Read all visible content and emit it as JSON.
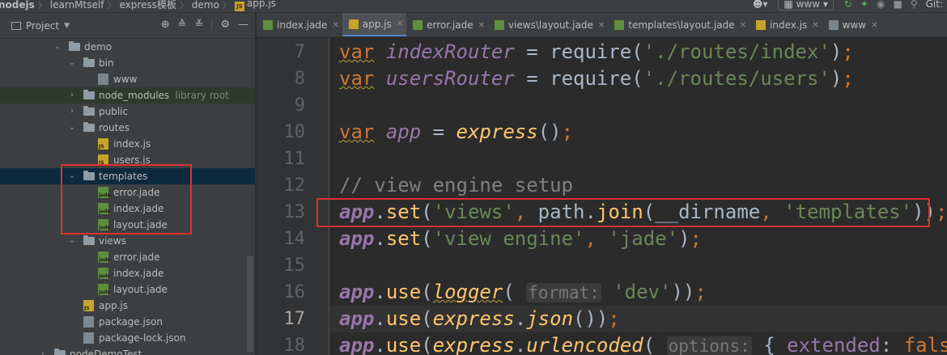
{
  "breadcrumb": {
    "items": [
      "nodejs",
      "learnMtself",
      "express模板",
      "demo",
      "app.js"
    ]
  },
  "toolbar": {
    "run_config": "www",
    "git_label": "Git:"
  },
  "project_panel": {
    "title": "Project",
    "tree": [
      {
        "label": "demo",
        "type": "folder",
        "depth": 0,
        "expanded": true
      },
      {
        "label": "bin",
        "type": "folder",
        "depth": 1,
        "expanded": true
      },
      {
        "label": "www",
        "type": "file-bin",
        "depth": 2
      },
      {
        "label": "node_modules",
        "type": "folder",
        "depth": 1,
        "expanded": false,
        "note": "library root"
      },
      {
        "label": "public",
        "type": "folder",
        "depth": 1,
        "expanded": false
      },
      {
        "label": "routes",
        "type": "folder",
        "depth": 1,
        "expanded": true
      },
      {
        "label": "index.js",
        "type": "file-js",
        "depth": 2
      },
      {
        "label": "users.js",
        "type": "file-js",
        "depth": 2
      },
      {
        "label": "templates",
        "type": "folder",
        "depth": 1,
        "expanded": true,
        "selected": true
      },
      {
        "label": "error.jade",
        "type": "file-jade",
        "depth": 2
      },
      {
        "label": "index.jade",
        "type": "file-jade",
        "depth": 2
      },
      {
        "label": "layout.jade",
        "type": "file-jade",
        "depth": 2
      },
      {
        "label": "views",
        "type": "folder",
        "depth": 1,
        "expanded": true
      },
      {
        "label": "error.jade",
        "type": "file-jade",
        "depth": 2
      },
      {
        "label": "index.jade",
        "type": "file-jade",
        "depth": 2
      },
      {
        "label": "layout.jade",
        "type": "file-jade",
        "depth": 2
      },
      {
        "label": "app.js",
        "type": "file-js",
        "depth": 1
      },
      {
        "label": "package.json",
        "type": "file-json",
        "depth": 1
      },
      {
        "label": "package-lock.json",
        "type": "file-json",
        "depth": 1
      },
      {
        "label": "nodeDemoTest",
        "type": "folder",
        "depth": -1,
        "expanded": false
      }
    ]
  },
  "editor": {
    "tabs": [
      {
        "label": "index.jade",
        "icon": "jade-file-icon",
        "active": false
      },
      {
        "label": "app.js",
        "icon": "js-file-icon",
        "active": true
      },
      {
        "label": "error.jade",
        "icon": "jade-file-icon",
        "active": false
      },
      {
        "label": "views\\layout.jade",
        "icon": "jade-file-icon",
        "active": false
      },
      {
        "label": "templates\\layout.jade",
        "icon": "jade-file-icon",
        "active": false
      },
      {
        "label": "index.js",
        "icon": "js-file-icon",
        "active": false
      },
      {
        "label": "www",
        "icon": "bin-file-icon",
        "active": false
      }
    ],
    "lines": [
      {
        "num": "7",
        "tokens": [
          [
            "kw warn",
            "var"
          ],
          [
            "plain",
            " "
          ],
          [
            "var",
            "indexRouter"
          ],
          [
            "plain",
            " = require("
          ],
          [
            "str",
            "'./routes/index'"
          ],
          [
            "plain",
            ")"
          ],
          [
            "kw",
            ";"
          ]
        ]
      },
      {
        "num": "8",
        "tokens": [
          [
            "kw warn",
            "var"
          ],
          [
            "plain",
            " "
          ],
          [
            "var",
            "usersRouter"
          ],
          [
            "plain",
            " = require("
          ],
          [
            "str",
            "'./routes/users'"
          ],
          [
            "plain",
            ")"
          ],
          [
            "kw",
            ";"
          ]
        ]
      },
      {
        "num": "9",
        "tokens": []
      },
      {
        "num": "10",
        "tokens": [
          [
            "kw warn",
            "var"
          ],
          [
            "plain",
            " "
          ],
          [
            "var",
            "app"
          ],
          [
            "plain",
            " = "
          ],
          [
            "fnit",
            "express"
          ],
          [
            "plain",
            "()"
          ],
          [
            "kw",
            ";"
          ]
        ]
      },
      {
        "num": "11",
        "tokens": []
      },
      {
        "num": "12",
        "tokens": [
          [
            "cm",
            "// view engine setup"
          ]
        ]
      },
      {
        "num": "13",
        "tokens": [
          [
            "glob",
            "app"
          ],
          [
            "plain",
            "."
          ],
          [
            "fn",
            "set"
          ],
          [
            "plain",
            "("
          ],
          [
            "str",
            "'views'"
          ],
          [
            "kw",
            ","
          ],
          [
            "plain",
            " path."
          ],
          [
            "fn",
            "join"
          ],
          [
            "plain",
            "(__dirname"
          ],
          [
            "kw",
            ","
          ],
          [
            "plain",
            " "
          ],
          [
            "str",
            "'templates'"
          ],
          [
            "plain",
            "))"
          ],
          [
            "kw",
            ";"
          ]
        ]
      },
      {
        "num": "14",
        "tokens": [
          [
            "glob",
            "app"
          ],
          [
            "plain",
            "."
          ],
          [
            "fn",
            "set"
          ],
          [
            "plain",
            "("
          ],
          [
            "str",
            "'view engine'"
          ],
          [
            "kw",
            ","
          ],
          [
            "plain",
            " "
          ],
          [
            "str",
            "'jade'"
          ],
          [
            "plain",
            ")"
          ],
          [
            "kw",
            ";"
          ]
        ]
      },
      {
        "num": "15",
        "tokens": []
      },
      {
        "num": "16",
        "tokens": [
          [
            "glob",
            "app"
          ],
          [
            "plain",
            "."
          ],
          [
            "fn",
            "use"
          ],
          [
            "plain",
            "("
          ],
          [
            "fnit und",
            "logger"
          ],
          [
            "plain",
            "( "
          ],
          [
            "hint",
            "format:"
          ],
          [
            "plain",
            " "
          ],
          [
            "str",
            "'dev'"
          ],
          [
            "plain",
            "))"
          ],
          [
            "kw",
            ";"
          ]
        ]
      },
      {
        "num": "17",
        "current": true,
        "tokens": [
          [
            "glob",
            "app"
          ],
          [
            "plain",
            "."
          ],
          [
            "fn",
            "use"
          ],
          [
            "plain",
            "("
          ],
          [
            "fnit",
            "express"
          ],
          [
            "plain",
            "."
          ],
          [
            "fnit",
            "json"
          ],
          [
            "plain",
            "())"
          ],
          [
            "kw",
            ";"
          ]
        ]
      },
      {
        "num": "18",
        "tokens": [
          [
            "glob",
            "app"
          ],
          [
            "plain",
            "."
          ],
          [
            "fn",
            "use"
          ],
          [
            "plain",
            "("
          ],
          [
            "fnit",
            "express"
          ],
          [
            "plain",
            "."
          ],
          [
            "fnit",
            "urlencoded"
          ],
          [
            "plain",
            "( "
          ],
          [
            "hint",
            "options:"
          ],
          [
            "plain",
            " { "
          ],
          [
            "prop",
            "extended"
          ],
          [
            "plain",
            ": "
          ],
          [
            "kw",
            "false"
          ],
          [
            "plain",
            " }"
          ]
        ]
      }
    ]
  },
  "colors": {
    "highlight_box": "#e03030",
    "selection": "#0d293e",
    "keyword": "#cc7832",
    "string": "#6a8759",
    "function": "#ffc66d",
    "variable": "#9876aa"
  }
}
